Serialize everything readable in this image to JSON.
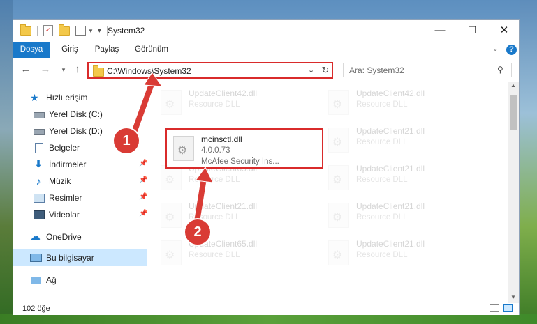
{
  "window": {
    "title": "System32",
    "controls": {
      "minimize": "—",
      "maximize": "☐",
      "close": "✕"
    }
  },
  "ribbon": {
    "tabs": [
      "Dosya",
      "Giriş",
      "Paylaş",
      "Görünüm"
    ],
    "expand_icon": "chevron-down-icon",
    "help_icon": "?"
  },
  "address": {
    "path": "C:\\Windows\\System32",
    "search_placeholder": "Ara: System32"
  },
  "sidebar": {
    "items": [
      {
        "label": "Hızlı erişim",
        "icon": "star-icon"
      },
      {
        "label": "Yerel Disk (C:)",
        "icon": "drive-icon"
      },
      {
        "label": "Yerel Disk (D:)",
        "icon": "drive-icon"
      },
      {
        "label": "Belgeler",
        "icon": "documents-icon"
      },
      {
        "label": "İndirmeler",
        "icon": "download-icon"
      },
      {
        "label": "Müzik",
        "icon": "music-icon"
      },
      {
        "label": "Resimler",
        "icon": "pictures-icon"
      },
      {
        "label": "Videolar",
        "icon": "videos-icon"
      },
      {
        "label": "OneDrive",
        "icon": "cloud-icon"
      },
      {
        "label": "Bu bilgisayar",
        "icon": "computer-icon"
      },
      {
        "label": "Ağ",
        "icon": "network-icon"
      }
    ]
  },
  "files": {
    "highlighted": {
      "name": "mcinsctl.dll",
      "version": "4.0.0.73",
      "description": "McAfee Security Ins..."
    },
    "ghost": [
      {
        "name": "UpdateClient42.dll",
        "desc": "Resource DLL"
      },
      {
        "name": "UpdateClient42.dll",
        "desc": "Resource DLL"
      },
      {
        "name": "UpdateClient21.dll",
        "desc": "Resource DLL"
      },
      {
        "name": "UpdateClient65.dll",
        "desc": "Resource DLL"
      },
      {
        "name": "UpdateClient21.dll",
        "desc": "Resource DLL"
      },
      {
        "name": "UpdateClient21.dll",
        "desc": "Resource DLL"
      },
      {
        "name": "UpdateClient21.dll",
        "desc": "Resource DLL"
      },
      {
        "name": "UpdateClient65.dll",
        "desc": "Resource DLL"
      },
      {
        "name": "UpdateClient21.dll",
        "desc": "Resource DLL"
      }
    ]
  },
  "status": {
    "item_count": "102 öğe"
  },
  "callouts": [
    "1",
    "2"
  ],
  "colors": {
    "accent": "#1979ca",
    "highlight": "#d92b2b",
    "selection": "#cce8ff"
  }
}
